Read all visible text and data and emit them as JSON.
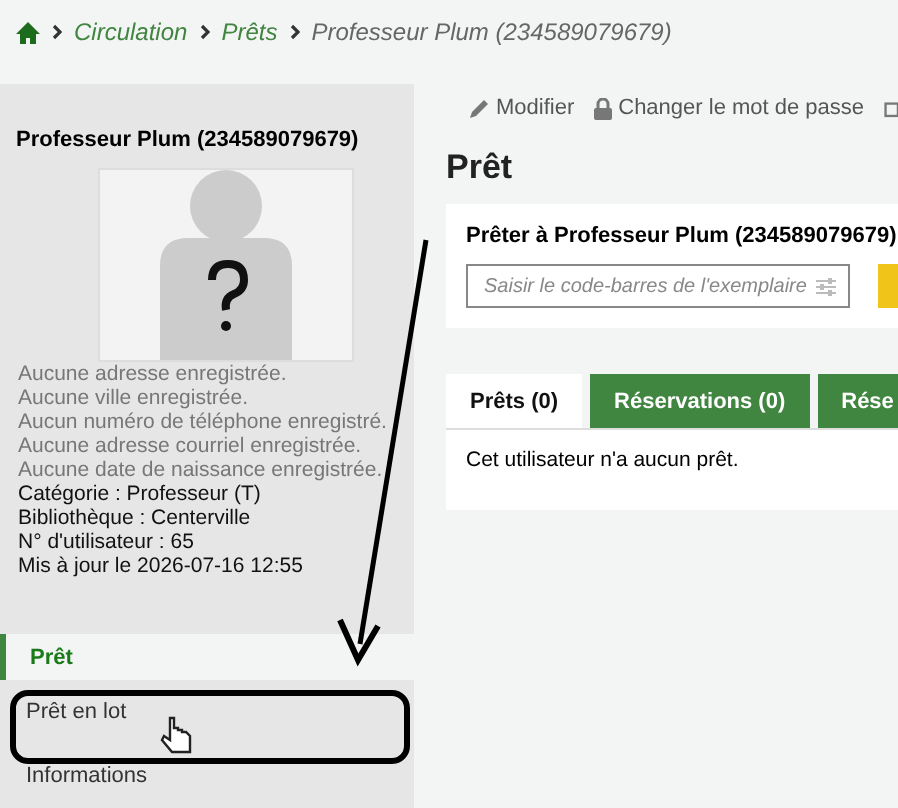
{
  "breadcrumb": [
    {
      "label": "Circulation",
      "kind": "link"
    },
    {
      "label": "Prêts",
      "kind": "link"
    },
    {
      "label": "Professeur Plum (234589079679)",
      "kind": "current"
    }
  ],
  "sidebar": {
    "patron_name": "Professeur Plum (234589079679)",
    "missing_info": [
      "Aucune adresse enregistrée.",
      "Aucune ville enregistrée.",
      "Aucun numéro de téléphone enregistré.",
      "Aucune adresse courriel enregistrée.",
      "Aucune date de naissance enregistrée."
    ],
    "details": [
      "Catégorie : Professeur (T)",
      "Bibliothèque : Centerville",
      "N° d'utilisateur : 65",
      "Mis à jour le 2026-07-16 12:55"
    ],
    "nav": [
      {
        "label": "Prêt",
        "selected": true
      },
      {
        "label": "Prêt en lot",
        "selected": false
      },
      {
        "label": "Informations",
        "selected": false
      }
    ]
  },
  "toolbar": [
    {
      "label": "Modifier",
      "kind": "edit"
    },
    {
      "label": "Changer le mot de passe",
      "kind": "lock"
    }
  ],
  "heading": "Prêt",
  "checkout": {
    "title": "Prêter à Professeur Plum (234589079679)",
    "placeholder": "Saisir le code-barres de l'exemplaire"
  },
  "tabs": [
    {
      "label": "Prêts (0)",
      "selected": true
    },
    {
      "label": "Réservations (0)",
      "selected": false
    },
    {
      "label": "Rése",
      "selected": false
    }
  ],
  "tab_content": "Cet utilisateur n'a aucun prêt."
}
